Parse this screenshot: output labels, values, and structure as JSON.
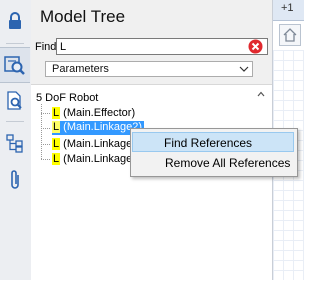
{
  "toolbar": {
    "buttons": [
      {
        "name": "lock-icon"
      },
      {
        "name": "search-tree-icon"
      },
      {
        "name": "search-document-icon"
      },
      {
        "name": "hierarchy-icon"
      },
      {
        "name": "paperclip-icon"
      }
    ],
    "active_index": 1
  },
  "panel": {
    "title": "Model Tree",
    "find_label": "Find:",
    "find_value": "L",
    "filter_selected": "Parameters"
  },
  "tree": {
    "root": "5 DoF Robot",
    "items": [
      {
        "mark": "L",
        "label": " (Main.Effector)",
        "selected": false
      },
      {
        "mark": "L",
        "label": " (Main.Linkage2)",
        "selected": true
      },
      {
        "mark": "L",
        "label": " (Main.Linkage",
        "selected": false
      },
      {
        "mark": "L",
        "label": " (Main.Linkage",
        "selected": false
      }
    ]
  },
  "context_menu": {
    "items": [
      {
        "label": "Find References",
        "highlighted": true
      },
      {
        "label": "Remove All References",
        "highlighted": false
      }
    ]
  },
  "right_strip": {
    "header": "+1"
  },
  "colors": {
    "selection": "#3399ff",
    "match_highlight": "#ffff00",
    "clear_button": "#e0282e",
    "toolbar_icon": "#2c64b0"
  }
}
